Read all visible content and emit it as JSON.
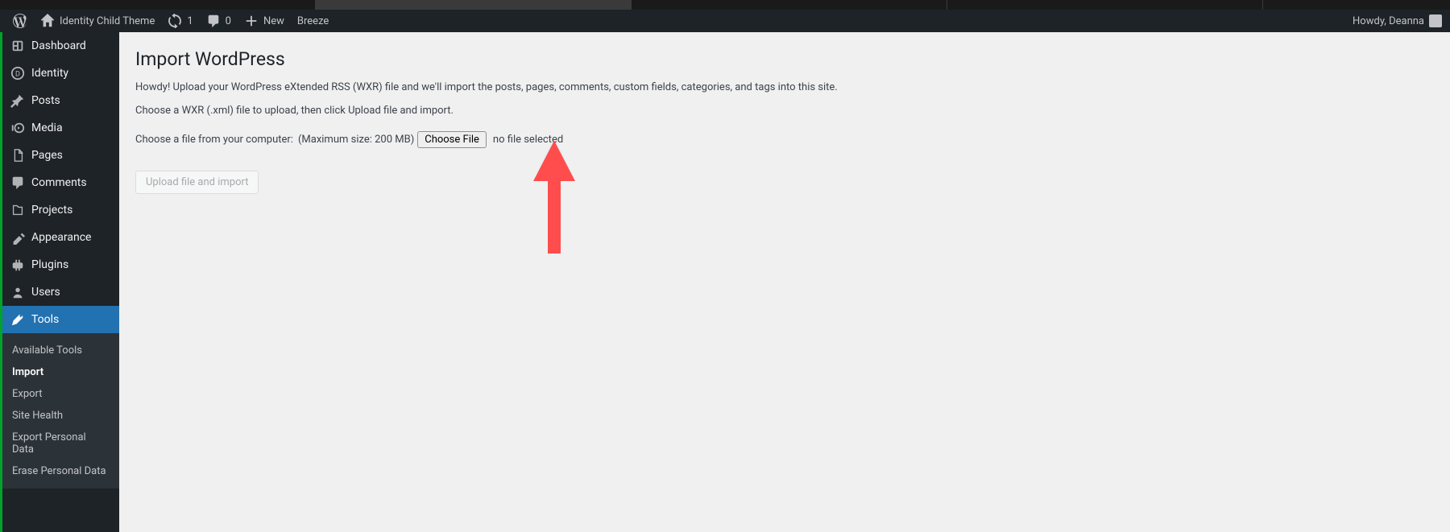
{
  "adminbar": {
    "site_name": "Identity Child Theme",
    "updates": "1",
    "comments": "0",
    "new_label": "New",
    "breeze_label": "Breeze",
    "howdy": "Howdy, Deanna"
  },
  "sidebar": {
    "items": [
      {
        "id": "dashboard",
        "label": "Dashboard"
      },
      {
        "id": "identity",
        "label": "Identity"
      },
      {
        "id": "posts",
        "label": "Posts"
      },
      {
        "id": "media",
        "label": "Media"
      },
      {
        "id": "pages",
        "label": "Pages"
      },
      {
        "id": "comments",
        "label": "Comments"
      },
      {
        "id": "projects",
        "label": "Projects"
      },
      {
        "id": "appearance",
        "label": "Appearance"
      },
      {
        "id": "plugins",
        "label": "Plugins"
      },
      {
        "id": "users",
        "label": "Users"
      },
      {
        "id": "tools",
        "label": "Tools"
      }
    ],
    "submenu": [
      {
        "label": "Available Tools"
      },
      {
        "label": "Import"
      },
      {
        "label": "Export"
      },
      {
        "label": "Site Health"
      },
      {
        "label": "Export Personal Data"
      },
      {
        "label": "Erase Personal Data"
      }
    ]
  },
  "page": {
    "title": "Import WordPress",
    "intro": "Howdy! Upload your WordPress eXtended RSS (WXR) file and we'll import the posts, pages, comments, custom fields, categories, and tags into this site.",
    "instruction": "Choose a WXR (.xml) file to upload, then click Upload file and import.",
    "choose_label": "Choose a file from your computer:",
    "max_size": "(Maximum size: 200 MB)",
    "choose_file_btn": "Choose File",
    "no_file": "no file selected",
    "submit": "Upload file and import"
  }
}
